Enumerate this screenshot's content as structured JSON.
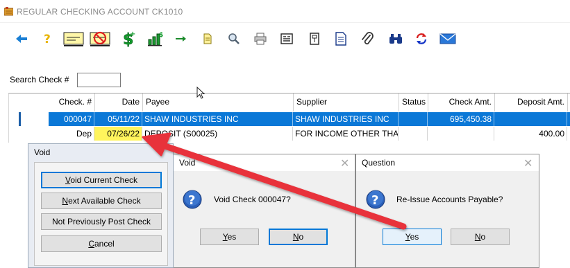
{
  "window": {
    "title": "REGULAR CHECKING ACCOUNT  CK1010"
  },
  "toolbar": {
    "icons": [
      "back-arrow-icon",
      "help-icon",
      "check-icon",
      "no-check-icon",
      "money-icon",
      "chart-icon",
      "go-arrow-icon",
      "note-icon",
      "find-icon",
      "print-icon",
      "list-icon",
      "document-icon",
      "report-icon",
      "attach-icon",
      "binoculars-icon",
      "refresh-icon",
      "email-icon"
    ]
  },
  "search": {
    "label": "Search Check #",
    "value": ""
  },
  "grid": {
    "columns": [
      "Check. #",
      "Date",
      "Payee",
      "Supplier",
      "Status",
      "Check Amt.",
      "Deposit Amt."
    ],
    "rows": [
      {
        "check": "000047",
        "date": "05/11/22",
        "payee": "SHAW INDUSTRIES INC",
        "supplier": "SHAW INDUSTRIES INC",
        "status": "",
        "check_amt": "695,450.38",
        "deposit_amt": ""
      },
      {
        "check": "Dep",
        "date": "07/26/22",
        "payee": "DEPOSIT (S00025)",
        "supplier": "FOR INCOME OTHER THAN",
        "status": "",
        "check_amt": "",
        "deposit_amt": "400.00"
      }
    ]
  },
  "void_dialog": {
    "title": "Void",
    "buttons": [
      "Void Current Check",
      "Next Available Check",
      "Not Previously Post Check",
      "Cancel"
    ]
  },
  "void_confirm": {
    "title": "Void",
    "message": "Void Check 000047?",
    "yes": "Yes",
    "no": "No"
  },
  "question_dialog": {
    "title": "Question",
    "message": "Re-Issue Accounts Payable?",
    "yes": "Yes",
    "no": "No"
  },
  "colors": {
    "selection": "#0b78d7",
    "highlight": "#fff45c",
    "annotation_arrow": "#e8333a"
  }
}
